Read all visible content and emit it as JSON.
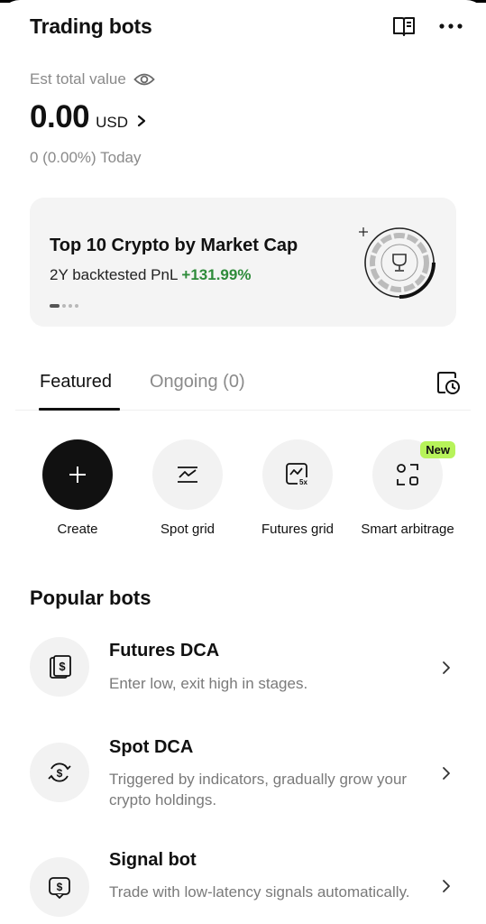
{
  "header": {
    "title": "Trading bots",
    "guide_icon": "book-icon",
    "more_icon": "more-horizontal-icon"
  },
  "summary": {
    "est_label": "Est total value",
    "value": "0.00",
    "currency": "USD",
    "change": "0 (0.00%)",
    "change_period": "Today"
  },
  "banner": {
    "title": "Top 10 Crypto by Market Cap",
    "sub_label": "2Y backtested PnL",
    "pnl": "+131.99%",
    "page_count": 4,
    "active_page": 1,
    "art_icon": "trophy-icon"
  },
  "tabs": {
    "featured": "Featured",
    "ongoing": "Ongoing (0)",
    "history_icon": "history-clock-icon"
  },
  "actions": [
    {
      "label": "Create",
      "icon": "plus-icon"
    },
    {
      "label": "Spot grid",
      "icon": "spot-grid-icon"
    },
    {
      "label": "Futures grid",
      "icon": "futures-grid-icon",
      "icon_text": "5x"
    },
    {
      "label": "Smart arbitrage",
      "icon": "arbitrage-icon",
      "badge": "New"
    }
  ],
  "popular": {
    "title": "Popular bots",
    "items": [
      {
        "name": "Futures DCA",
        "desc": "Enter low, exit high in stages.",
        "icon": "futures-dca-icon"
      },
      {
        "name": "Spot DCA",
        "desc": "Triggered by indicators, gradually grow your crypto holdings.",
        "icon": "spot-dca-icon"
      },
      {
        "name": "Signal bot",
        "desc": "Trade with low-latency signals automatically.",
        "icon": "signal-bot-icon"
      }
    ]
  },
  "colors": {
    "accent_green": "#2e8b3a",
    "badge_green": "#b7f35a",
    "muted": "#8a8a8a"
  }
}
